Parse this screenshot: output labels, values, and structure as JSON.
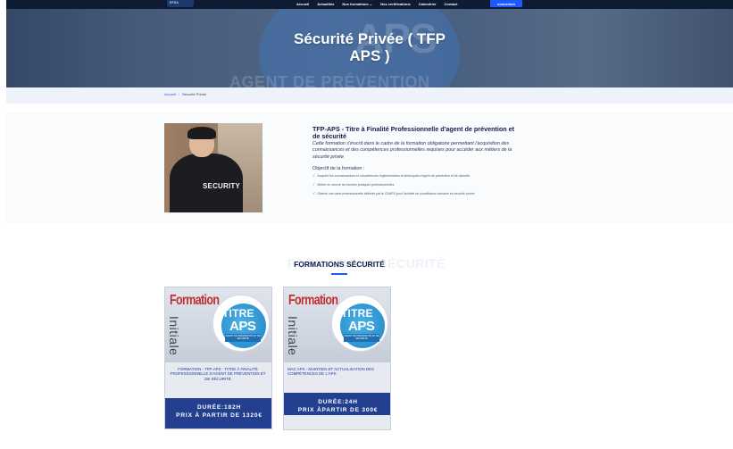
{
  "nav": {
    "logo_text": "EFSA",
    "links": [
      "Accueil",
      "Actualités",
      "Nos formations ⌄",
      "Nos certifications",
      "Calendrier",
      "Contact"
    ],
    "button": "connexion"
  },
  "hero": {
    "title_line1": "Sécurité Privée ( TFP",
    "title_line2": "APS )",
    "watermark_top": "APS",
    "watermark_bottom": "AGENT DE PRÉVENTION"
  },
  "breadcrumb": {
    "home": "Accueil",
    "separator": "/",
    "current": "Sécurité Privée"
  },
  "intro": {
    "image_label": "SECURITY",
    "title": "TFP-APS - Titre à Finalité Professionnelle d'agent de prévention et de sécurité",
    "description": "Cette formation s'inscrit dans le cadre de la formation obligatoire permettant l'acquisition des connaissances et des compétences professionnelles requises pour accéder aux métiers de la sécurité privée",
    "objective_label": "Objectif de la formation :",
    "objectives": [
      "Acquérir les connaissances et compétences réglementaires et techniques d'agent de prévention et de sécurité",
      "Mettre en oeuvre les bonnes pratiques professionnelles",
      "Obtenir une carte professionnelle délivrée par le CNAPS pour l'activité de surveillance humaine en sécurité privée"
    ],
    "check_icon": "check-icon"
  },
  "formations": {
    "ghost_title": "FORMATIONS SÉCURITÉ",
    "title": "FORMATIONS SÉCURITÉ",
    "cards": [
      {
        "thumb_formation": "Formation",
        "thumb_initiale": "Initiale",
        "thumb_titre": "TITRE",
        "thumb_aps": "APS",
        "thumb_band": "AGENT DE PRÉVENTION ET DE SÉCURITÉ",
        "title": "FORMATION - TFP-APS - TITRE À FINALITÉ PROFESSIONNELLE D'AGENT DE PRÉVENTION ET DE SÉCURITÉ",
        "duration": "DURÉE:182H",
        "price": "PRIX À PARTIR DE 1320€"
      },
      {
        "thumb_formation": "Formation",
        "thumb_initiale": "Initiale",
        "thumb_titre": "TITRE",
        "thumb_aps": "APS",
        "thumb_band": "AGENT DE PRÉVENTION ET DE SÉCURITÉ",
        "title": "MAC APS - MAINTIEN ET ACTUALISATION DES COMPÉTENCES DE L'APS",
        "duration": "DURÉE:24H",
        "price": "PRIX ÀPARTIR DE 300€"
      }
    ]
  },
  "colors": {
    "nav_bg": "#0d1b33",
    "accent": "#1d5bff",
    "card_footer": "#223f90",
    "title": "#0b1e4a"
  }
}
